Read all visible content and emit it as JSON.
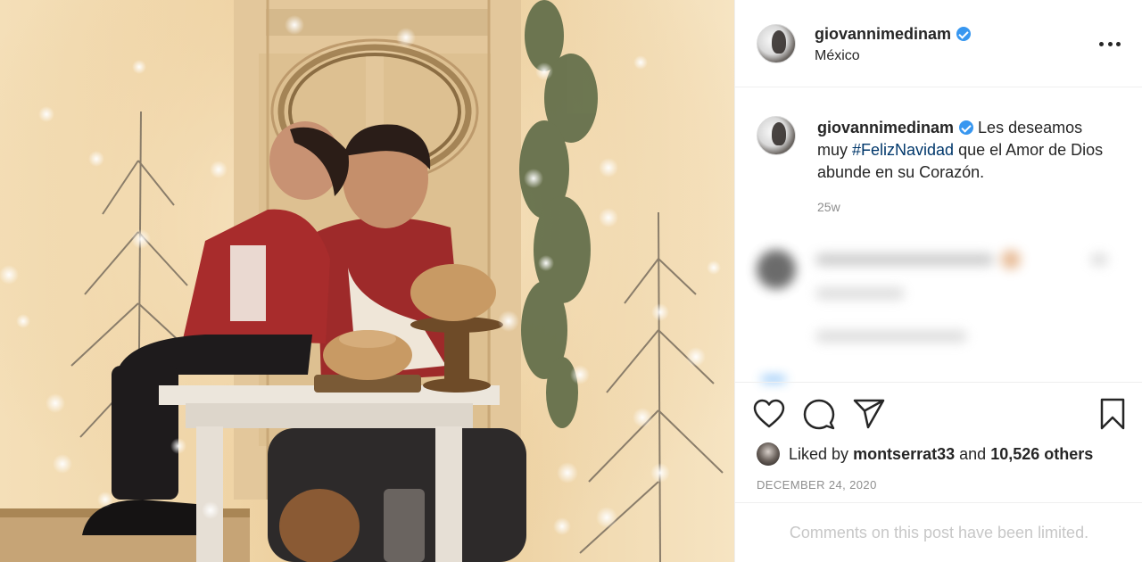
{
  "post": {
    "username": "giovannimedinam",
    "location": "México",
    "verified_icon": "verified-badge-icon",
    "more_icon": "more-options-icon"
  },
  "caption": {
    "username": "giovannimedinam",
    "text_before": "Les deseamos muy ",
    "hashtag": "#FelizNavidad",
    "text_after": " que el Amor de Dios abunde en su Corazón.",
    "age": "25w"
  },
  "actions": {
    "like_icon": "heart-icon",
    "comment_icon": "comment-icon",
    "share_icon": "share-icon",
    "save_icon": "bookmark-icon"
  },
  "likes": {
    "prefix": "Liked by",
    "user": "montserrat33",
    "middle": "and",
    "others": "10,526 others"
  },
  "date": "DECEMBER 24, 2020",
  "comments_notice": "Comments on this post have been limited.",
  "colors": {
    "text": "#262626",
    "secondary": "#8e8e8e",
    "hashtag": "#00376b",
    "verified": "#3897f0",
    "border": "#efefef"
  }
}
